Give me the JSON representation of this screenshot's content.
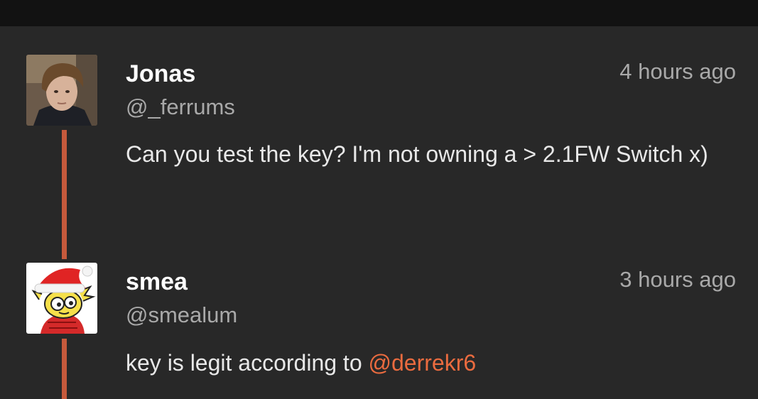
{
  "theme": {
    "background": "#282828",
    "status_bar": "#121212",
    "thread_line": "#c65a3c",
    "mention_color": "#ea6b3f",
    "text_primary": "#ffffff",
    "text_secondary": "#a9a9a9"
  },
  "tweets": [
    {
      "name": "Jonas",
      "handle": "@_ferrums",
      "time": "4 hours ago",
      "text": "Can you test the key? I'm not owning a > 2.1FW Switch x)",
      "avatar": "user-photo"
    },
    {
      "name": "smea",
      "handle": "@smealum",
      "time": "3 hours ago",
      "text_prefix": "key is legit according to ",
      "mention": "@derrekr6",
      "avatar": "cartoon-santa-hat"
    }
  ]
}
